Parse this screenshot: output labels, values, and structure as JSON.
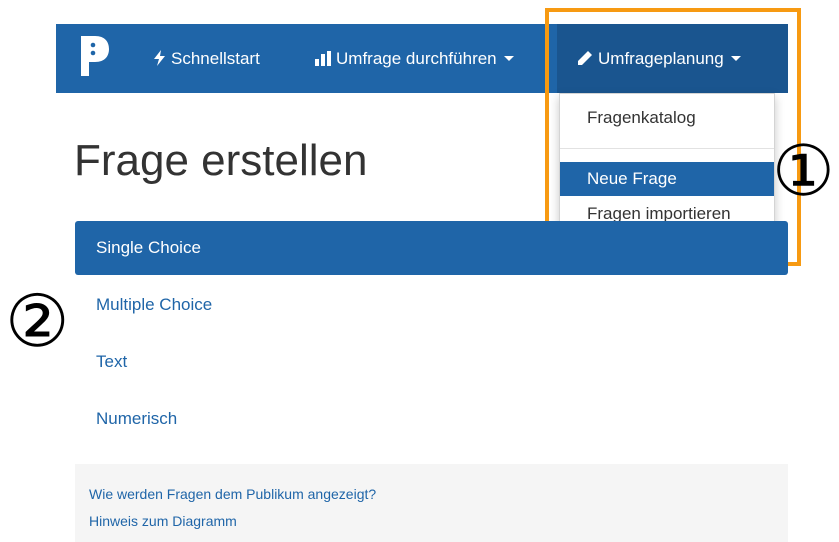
{
  "navbar": {
    "logo_text": "P",
    "items": [
      {
        "label": "Schnellstart",
        "icon": "bolt-icon"
      },
      {
        "label": "Umfrage durchführen",
        "icon": "bar-chart-icon",
        "has_caret": true
      },
      {
        "label": "Umfrageplanung",
        "icon": "pencil-icon",
        "has_caret": true,
        "active": true
      }
    ]
  },
  "dropdown": {
    "items": [
      {
        "label": "Fragenkatalog"
      },
      {
        "label": "Neue Frage",
        "active": true
      },
      {
        "label": "Fragen importieren"
      }
    ]
  },
  "annotations": {
    "marker_1": "①",
    "marker_2": "②",
    "highlight_color": "#f79a12"
  },
  "page": {
    "title": "Frage erstellen",
    "question_types": [
      {
        "label": "Single Choice",
        "active": true
      },
      {
        "label": "Multiple Choice"
      },
      {
        "label": "Text"
      },
      {
        "label": "Numerisch"
      }
    ]
  },
  "info": {
    "link_1": "Wie werden Fragen dem Publikum angezeigt?",
    "link_2": "Hinweis zum Diagramm"
  },
  "colors": {
    "primary": "#1f65a8",
    "primary_dark": "#1a558f",
    "text": "#333333"
  }
}
